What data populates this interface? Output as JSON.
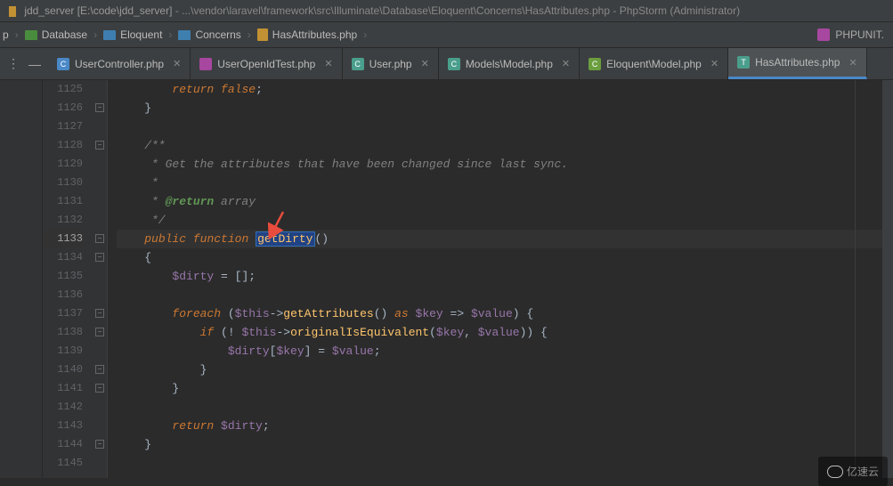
{
  "title": {
    "project": "jdd_server [E:\\code\\jdd_server]",
    "path": "- ...\\vendor\\laravel\\framework\\src\\Illuminate\\Database\\Eloquent\\Concerns\\HasAttributes.php",
    "ide": "- PhpStorm (Administrator)"
  },
  "breadcrumb": {
    "items": [
      "p",
      "Database",
      "Eloquent",
      "Concerns",
      "HasAttributes.php"
    ]
  },
  "phpunit_label": "PHPUNIT.",
  "toolbar": {
    "dots": "⋮",
    "dash": "—"
  },
  "tabs": [
    {
      "label": "UserController.php",
      "icon": "blue"
    },
    {
      "label": "UserOpenIdTest.php",
      "icon": "purple"
    },
    {
      "label": "User.php",
      "icon": "teal"
    },
    {
      "label": "Models\\Model.php",
      "icon": "teal"
    },
    {
      "label": "Eloquent\\Model.php",
      "icon": "green"
    },
    {
      "label": "HasAttributes.php",
      "icon": "teal",
      "active": true
    }
  ],
  "gutter": {
    "start": 1125,
    "end": 1145,
    "current": 1133
  },
  "code": {
    "l1125": {
      "return": "return",
      "false": "false",
      "semicolon": ";"
    },
    "l1126": "    }",
    "l1127": "",
    "l1128": "    /**",
    "l1129": "     * Get the attributes that have been changed since last sync.",
    "l1130": "     *",
    "l1131": {
      "prefix": "     * ",
      "tag": "@return",
      "type": " array"
    },
    "l1132": "     */",
    "l1133": {
      "public": "public",
      "function": "function",
      "name": "getDirty",
      "parens": "()"
    },
    "l1134": "    {",
    "l1135": {
      "var": "$dirty",
      "eq": " = ",
      "arr": "[]",
      "semi": ";"
    },
    "l1136": "",
    "l1137": {
      "foreach": "foreach",
      "open": " (",
      "this": "$this",
      "arrow": "->",
      "method": "getAttributes",
      "call": "()",
      "as": " as ",
      "key": "$key",
      "fat": " => ",
      "val": "$value",
      "close": ") {"
    },
    "l1138": {
      "if": "if",
      "open": " (! ",
      "this": "$this",
      "arrow": "->",
      "method": "originalIsEquivalent",
      "popen": "(",
      "key": "$key",
      "comma": ", ",
      "val": "$value",
      "pclose": "))",
      "brace": " {"
    },
    "l1139": {
      "dirty": "$dirty",
      "open": "[",
      "key": "$key",
      "close": "]",
      "eq": " = ",
      "val": "$value",
      "semi": ";"
    },
    "l1140": "            }",
    "l1141": "        }",
    "l1142": "",
    "l1143": {
      "return": "return",
      "var": " $dirty",
      "semi": ";"
    },
    "l1144": "    }",
    "l1145": ""
  },
  "watermark": "亿速云"
}
